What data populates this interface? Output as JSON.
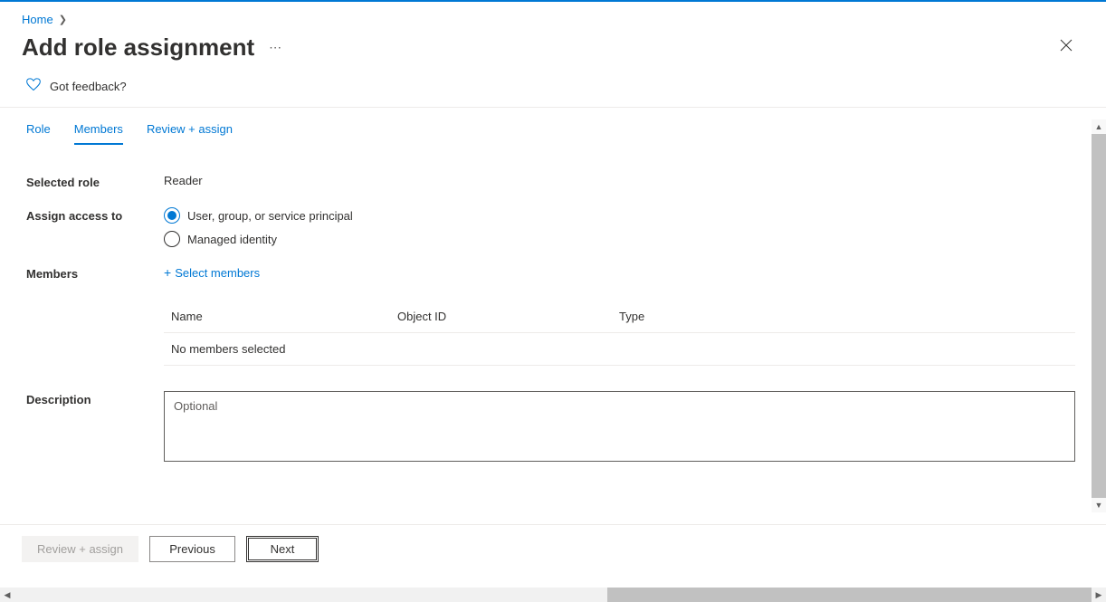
{
  "breadcrumb": {
    "home": "Home"
  },
  "page": {
    "title": "Add role assignment"
  },
  "feedback": {
    "label": "Got feedback?"
  },
  "tabs": {
    "role": "Role",
    "members": "Members",
    "review": "Review + assign"
  },
  "form": {
    "selected_role_label": "Selected role",
    "selected_role_value": "Reader",
    "assign_access_label": "Assign access to",
    "radio_option_1": "User, group, or service principal",
    "radio_option_2": "Managed identity",
    "members_label": "Members",
    "select_members_link": "Select members",
    "description_label": "Description",
    "description_placeholder": "Optional"
  },
  "table": {
    "col_name": "Name",
    "col_object_id": "Object ID",
    "col_type": "Type",
    "empty_message": "No members selected"
  },
  "buttons": {
    "review_assign": "Review + assign",
    "previous": "Previous",
    "next": "Next"
  }
}
